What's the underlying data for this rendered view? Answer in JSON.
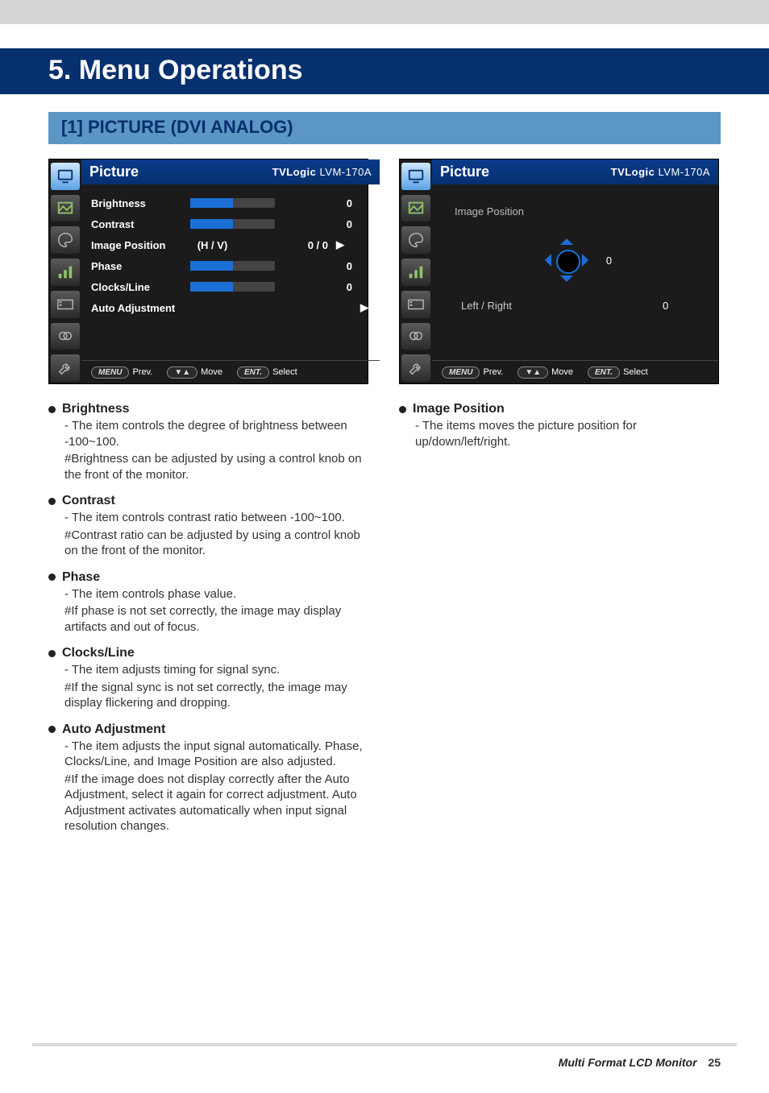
{
  "chapter": {
    "title": "5. Menu Operations"
  },
  "section": {
    "title": "[1] PICTURE (DVI ANALOG)"
  },
  "osd_left": {
    "title": "Picture",
    "brand_bold": "TVLogic",
    "brand_model": "LVM-170A",
    "rows": [
      {
        "label": "Brightness",
        "type": "slider",
        "value": "0"
      },
      {
        "label": "Contrast",
        "type": "slider",
        "value": "0"
      },
      {
        "label": "Image Position",
        "type": "nav",
        "mid": "(H / V)",
        "value": "0 / 0"
      },
      {
        "label": "Phase",
        "type": "slider",
        "value": "0"
      },
      {
        "label": "Clocks/Line",
        "type": "slider",
        "value": "0"
      },
      {
        "label": "Auto Adjustment",
        "type": "enter"
      }
    ],
    "footer": {
      "prev_pill": "MENU",
      "prev": "Prev.",
      "move_pill": "▼▲",
      "move": "Move",
      "sel_pill": "ENT.",
      "sel": "Select"
    }
  },
  "osd_right": {
    "title": "Picture",
    "brand_bold": "TVLogic",
    "brand_model": "LVM-170A",
    "subtitle": "Image Position",
    "hv_value": "0",
    "lr_label": "Left / Right",
    "lr_value": "0",
    "footer": {
      "prev_pill": "MENU",
      "prev": "Prev.",
      "move_pill": "▼▲",
      "move": "Move",
      "sel_pill": "ENT.",
      "sel": "Select"
    }
  },
  "descriptions_left": [
    {
      "title": "Brightness",
      "lines": [
        {
          "p": "- ",
          "t": "The item controls the degree of brightness between -100~100."
        },
        {
          "p": "#",
          "t": "Brightness can be adjusted by using a control knob on the front of the monitor."
        }
      ]
    },
    {
      "title": "Contrast",
      "lines": [
        {
          "p": "- ",
          "t": "The item controls contrast ratio between -100~100."
        },
        {
          "p": "#",
          "t": "Contrast ratio can be adjusted by using a control knob on the front of the monitor."
        }
      ]
    },
    {
      "title": "Phase",
      "lines": [
        {
          "p": "- ",
          "t": "The item controls phase value."
        },
        {
          "p": "#",
          "t": "If phase is not set correctly, the image may display artifacts and out of focus."
        }
      ]
    },
    {
      "title": "Clocks/Line",
      "lines": [
        {
          "p": "- ",
          "t": "The item adjusts timing for signal sync."
        },
        {
          "p": "#",
          "t": "If the signal sync is not set correctly, the image may display flickering and dropping."
        }
      ]
    },
    {
      "title": "Auto Adjustment",
      "lines": [
        {
          "p": "- ",
          "t": "The item adjusts the input signal automatically. Phase, Clocks/Line, and Image Position are also adjusted."
        },
        {
          "p": "#",
          "t": "If the image does not display correctly after the Auto Adjustment, select it again for correct adjustment. Auto Adjustment activates automatically when input signal resolution changes."
        }
      ]
    }
  ],
  "descriptions_right": [
    {
      "title": "Image Position",
      "lines": [
        {
          "p": "- ",
          "t": "The items moves the picture position for up/down/left/right."
        }
      ]
    }
  ],
  "icons": [
    "monitor-icon",
    "picture-icon",
    "palette-icon",
    "levels-icon",
    "video-icon",
    "rings-icon",
    "wrench-icon"
  ],
  "footer": {
    "name": "Multi Format LCD Monitor",
    "page": "25"
  }
}
